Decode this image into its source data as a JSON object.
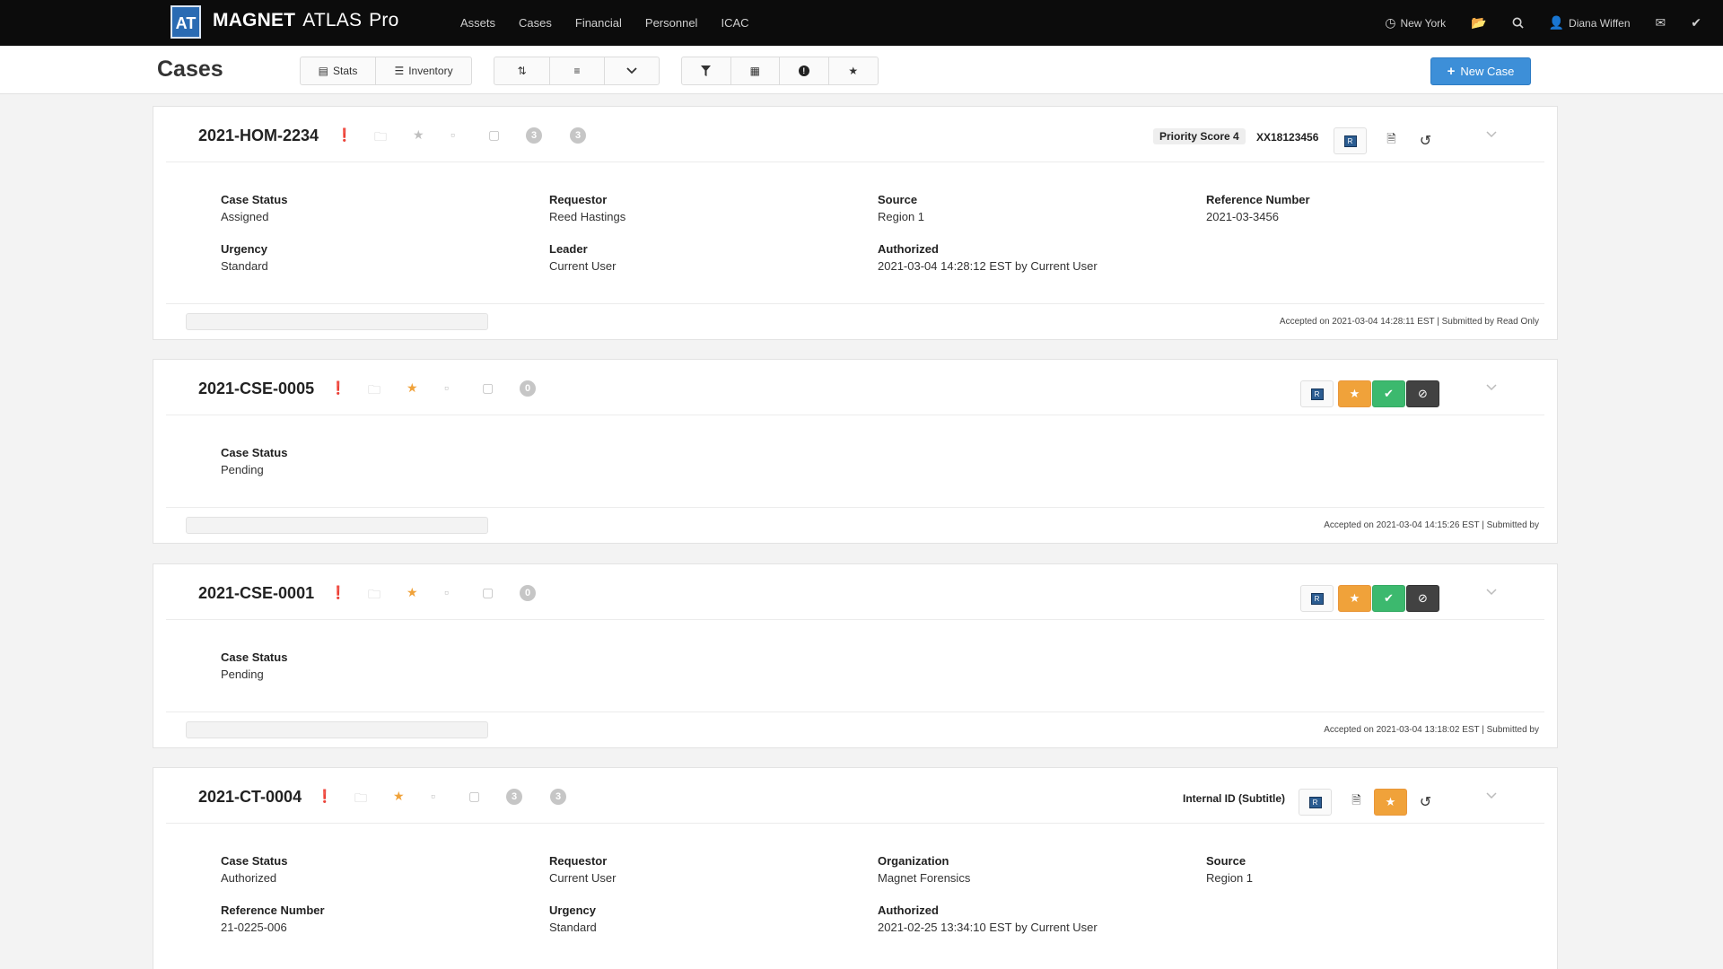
{
  "app": {
    "logo_mark": "AT",
    "brand_bold": "MAGNET",
    "brand_mid": "ATLAS",
    "brand_pro": "Pro"
  },
  "nav": {
    "items": [
      "Assets",
      "Cases",
      "Financial",
      "Personnel",
      "ICAC"
    ],
    "location": "New York",
    "user": "Diana Wiffen"
  },
  "page": {
    "title": "Cases",
    "stats_label": "Stats",
    "inventory_label": "Inventory",
    "new_case_label": "New Case"
  },
  "icons": {
    "stats": "bar-chart-icon",
    "inventory": "list-icon",
    "sort": "sort-icon",
    "list": "list-icon",
    "chevron": "chevron-down-icon",
    "filter": "filter-icon",
    "calendar": "calendar-icon",
    "alert": "alert-circle-icon",
    "star": "star-icon",
    "folder": "folder-icon",
    "clipboard": "clipboard-icon",
    "trash": "trash-icon",
    "file": "file-icon",
    "undo": "undo-icon",
    "check": "check-icon",
    "ban": "ban-icon"
  },
  "colors": {
    "accent": "#3d8fd8",
    "danger": "#d9322e",
    "star": "#f0a23a",
    "success": "#3cb96e",
    "dark": "#424242"
  },
  "cases": [
    {
      "id": "2021-HOM-2234",
      "starred": false,
      "badges": [
        "3",
        "3"
      ],
      "priority": "Priority Score 4",
      "external_id": "XX18123456",
      "fields": [
        {
          "label": "Case Status",
          "value": "Assigned"
        },
        {
          "label": "Requestor",
          "value": "Reed Hastings"
        },
        {
          "label": "Source",
          "value": "Region 1"
        },
        {
          "label": "Reference Number",
          "value": "2021-03-3456"
        },
        {
          "label": "Urgency",
          "value": "Standard"
        },
        {
          "label": "Leader",
          "value": "Current User"
        },
        {
          "label": "Authorized",
          "value": "2021-03-04 14:28:12 EST by Current User"
        }
      ],
      "progress": 0,
      "footer": "Accepted on 2021-03-04 14:28:11 EST | Submitted by Read Only"
    },
    {
      "id": "2021-CSE-0005",
      "starred": true,
      "badges": [
        "0"
      ],
      "fields": [
        {
          "label": "Case Status",
          "value": "Pending"
        }
      ],
      "progress": 0,
      "footer": "Accepted on 2021-03-04 14:15:26 EST | Submitted by"
    },
    {
      "id": "2021-CSE-0001",
      "starred": true,
      "badges": [
        "0"
      ],
      "fields": [
        {
          "label": "Case Status",
          "value": "Pending"
        }
      ],
      "progress": 0,
      "footer": "Accepted on 2021-03-04 13:18:02 EST | Submitted by"
    },
    {
      "id": "2021-CT-0004",
      "starred": true,
      "badges": [
        "3",
        "3"
      ],
      "internal_id": "Internal ID (Subtitle)",
      "fields": [
        {
          "label": "Case Status",
          "value": "Authorized"
        },
        {
          "label": "Requestor",
          "value": "Current User"
        },
        {
          "label": "Organization",
          "value": "Magnet Forensics"
        },
        {
          "label": "Source",
          "value": "Region 1"
        },
        {
          "label": "Reference Number",
          "value": "21-0225-006"
        },
        {
          "label": "Urgency",
          "value": "Standard"
        },
        {
          "label": "Authorized",
          "value": "2021-02-25 13:34:10 EST by Current User"
        }
      ]
    }
  ]
}
